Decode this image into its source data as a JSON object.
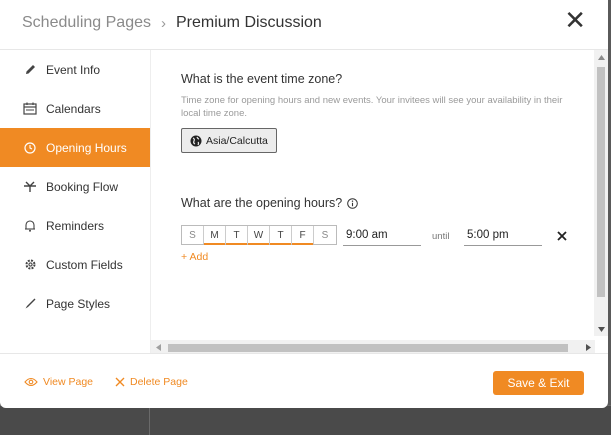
{
  "header": {
    "breadcrumb_parent": "Scheduling Pages",
    "breadcrumb_separator": "›",
    "title": "Premium Discussion",
    "close_icon": "close-icon"
  },
  "sidebar": {
    "items": [
      {
        "label": "Event Info",
        "icon": "pencil-icon"
      },
      {
        "label": "Calendars",
        "icon": "calendar-icon"
      },
      {
        "label": "Opening Hours",
        "icon": "clock-icon",
        "active": true
      },
      {
        "label": "Booking Flow",
        "icon": "flow-icon"
      },
      {
        "label": "Reminders",
        "icon": "bell-icon"
      },
      {
        "label": "Custom Fields",
        "icon": "gear-icon"
      },
      {
        "label": "Page Styles",
        "icon": "brush-icon"
      }
    ]
  },
  "timezone": {
    "question": "What is the event time zone?",
    "hint": "Time zone for opening hours and new events. Your invitees will see your availability in their local time zone.",
    "value": "Asia/Calcutta"
  },
  "opening_hours": {
    "question": "What are the opening hours?",
    "days": [
      {
        "label": "S",
        "selected": false
      },
      {
        "label": "M",
        "selected": true
      },
      {
        "label": "T",
        "selected": true
      },
      {
        "label": "W",
        "selected": true
      },
      {
        "label": "T",
        "selected": true
      },
      {
        "label": "F",
        "selected": true
      },
      {
        "label": "S",
        "selected": false
      }
    ],
    "start_time": "9:00 am",
    "until_label": "until",
    "end_time": "5:00 pm",
    "add_label": "+ Add"
  },
  "footer": {
    "view_label": "View Page",
    "delete_label": "Delete Page",
    "save_label": "Save & Exit"
  },
  "colors": {
    "accent": "#f08a23",
    "active_text": "#ffffff"
  }
}
